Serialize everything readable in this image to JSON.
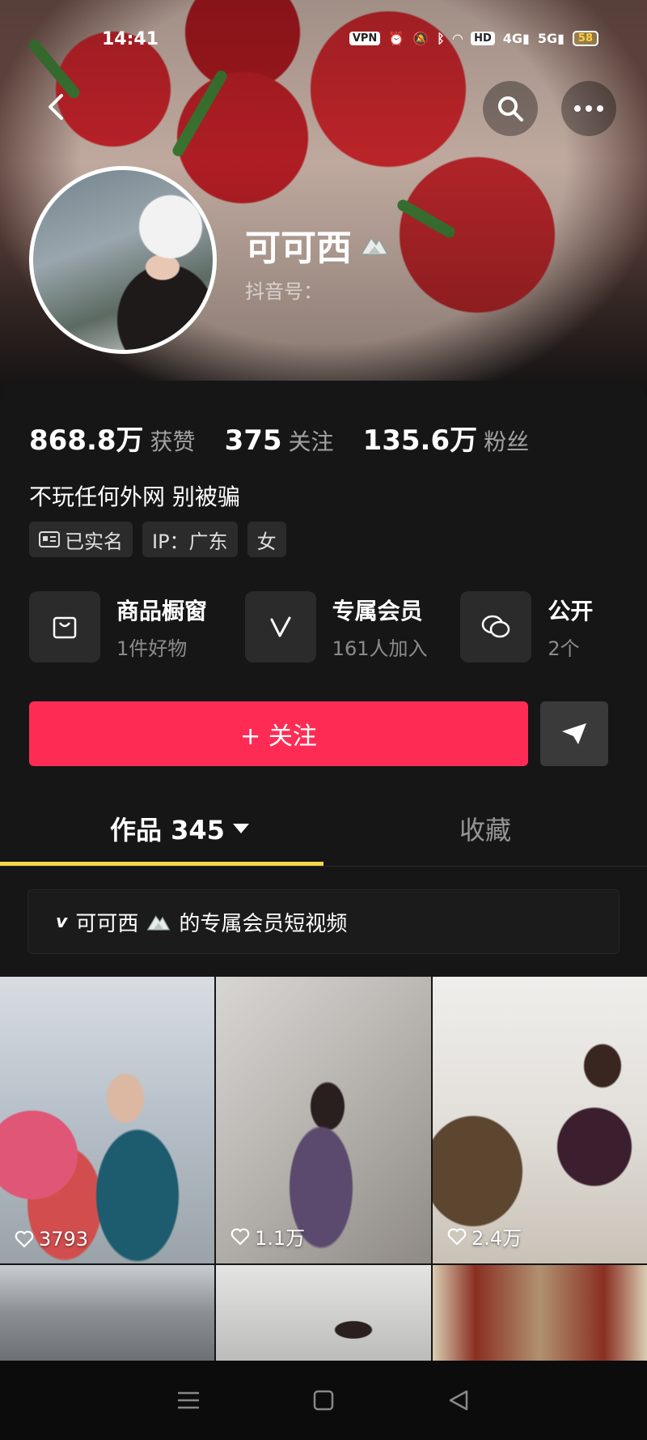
{
  "status_bar": {
    "time": "14:41",
    "vpn": "VPN",
    "hd": "HD",
    "net1": "4G",
    "net2": "5G",
    "battery": "58"
  },
  "profile": {
    "nickname": "可可西",
    "douyin_id_label": "抖音号：",
    "stats": [
      {
        "value": "868.8万",
        "label": "获赞"
      },
      {
        "value": "375",
        "label": "关注"
      },
      {
        "value": "135.6万",
        "label": "粉丝"
      }
    ],
    "bio": "不玩任何外网 别被骗",
    "tags": [
      {
        "label": "已实名",
        "icon": "id-card-icon"
      },
      {
        "label": "IP：广东"
      },
      {
        "label": "女"
      }
    ]
  },
  "features": [
    {
      "title": "商品橱窗",
      "subtitle": "1件好物",
      "icon": "shopping-bag-icon"
    },
    {
      "title": "专属会员",
      "subtitle": "161人加入",
      "icon": "v-member-icon"
    },
    {
      "title": "公开",
      "subtitle": "2个",
      "icon": "chat-group-icon"
    }
  ],
  "actions": {
    "follow_label": "+ 关注",
    "share_icon": "send-icon"
  },
  "tabs": {
    "works": "作品 345",
    "collect": "收藏"
  },
  "member_banner": {
    "prefix": "v",
    "text": "可可西",
    "suffix": "的专属会员短视频"
  },
  "videos": [
    {
      "likes": "3793"
    },
    {
      "likes": "1.1万"
    },
    {
      "likes": "2.4万"
    },
    {
      "likes": ""
    },
    {
      "likes": ""
    },
    {
      "likes": ""
    }
  ],
  "colors": {
    "accent": "#fe2c55",
    "tab_underline": "#fbd54a",
    "background": "#161616"
  }
}
